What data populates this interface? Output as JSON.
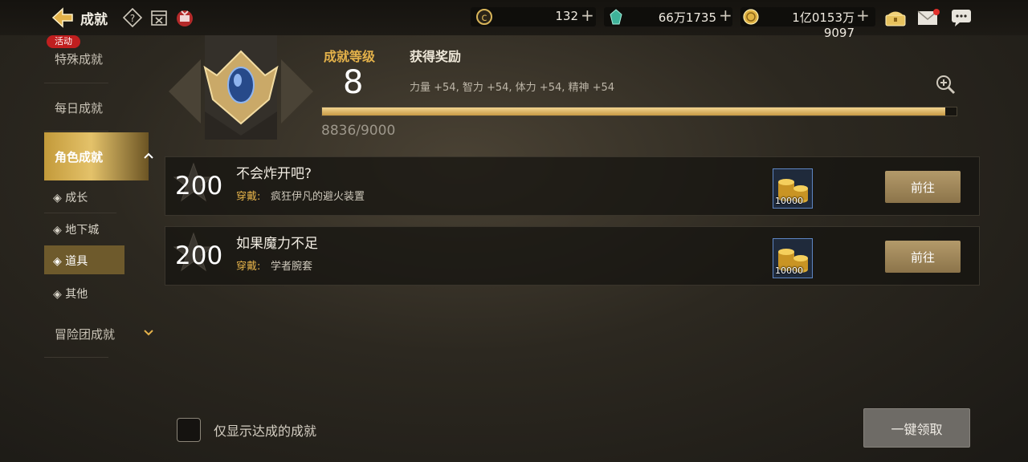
{
  "header": {
    "title": "成就"
  },
  "resources": [
    {
      "icon": "gold-c-coin-icon",
      "value": "132"
    },
    {
      "icon": "green-gem-icon",
      "value": "66万1735"
    },
    {
      "icon": "gold-coin-icon",
      "value": "1亿0153万9097"
    }
  ],
  "sidebar": {
    "badge": "活动",
    "items": [
      {
        "label": "特殊成就"
      },
      {
        "label": "每日成就"
      },
      {
        "label": "角色成就"
      },
      {
        "label": "冒险团成就"
      }
    ],
    "sub_items": [
      {
        "label": "◈ 成长"
      },
      {
        "label": "◈ 地下城"
      },
      {
        "label": "◈ 道具"
      },
      {
        "label": "◈ 其他"
      }
    ]
  },
  "level": {
    "label": "成就等级",
    "value": "8",
    "reward_label": "获得奖励",
    "reward_text": "力量 +54, 智力 +54, 体力 +54, 精神 +54",
    "progress_text": "8836/9000",
    "progress": 0.982
  },
  "achievements": [
    {
      "points": "200",
      "name": "不会炸开吧?",
      "wear_label": "穿戴:",
      "wear_item": "疯狂伊凡的避火装置",
      "reward_qty": "10000",
      "button": "前往"
    },
    {
      "points": "200",
      "name": "如果魔力不足",
      "wear_label": "穿戴:",
      "wear_item": "学者腕套",
      "reward_qty": "10000",
      "button": "前往"
    }
  ],
  "footer": {
    "checkbox_label": "仅显示达成的成就",
    "claim_all": "一键领取"
  },
  "colors": {
    "accent": "#e4b24a",
    "badge": "#c01f1f"
  }
}
